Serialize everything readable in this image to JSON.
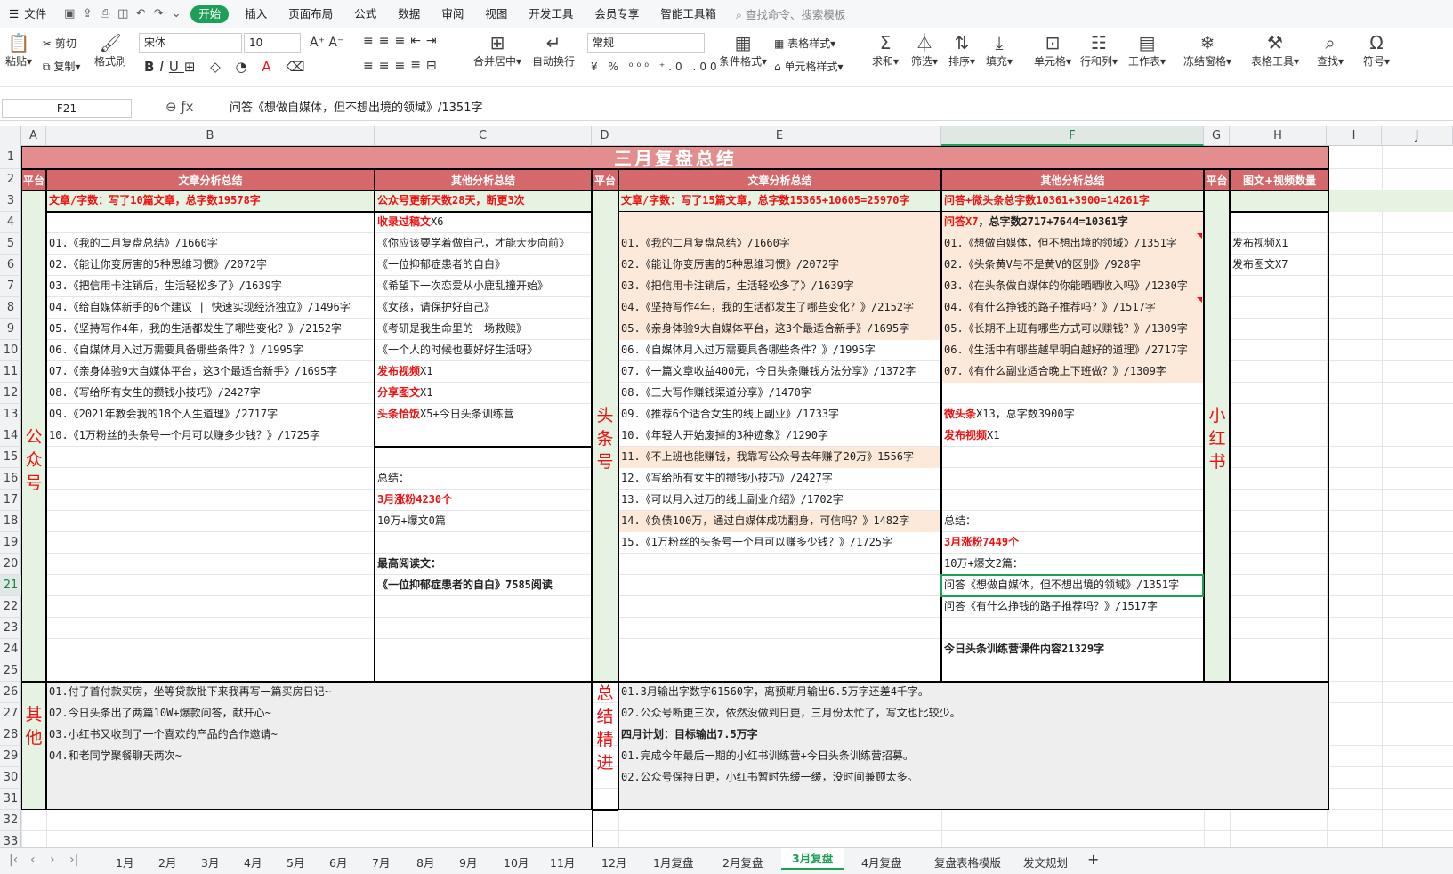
{
  "menu": {
    "file": "文件",
    "tabs": [
      "开始",
      "插入",
      "页面布局",
      "公式",
      "数据",
      "审阅",
      "视图",
      "开发工具",
      "会员专享",
      "智能工具箱"
    ],
    "search": "查找命令、搜索模板"
  },
  "ribbon": {
    "paste": "粘贴",
    "cut": "剪切",
    "copy": "复制",
    "format_painter": "格式刷",
    "font": "宋体",
    "size": "10",
    "merge": "合并居中",
    "wrap": "自动换行",
    "numfmt": "常规",
    "cond_format": "条件格式",
    "table_style": "表格样式",
    "cell_style": "单元格样式",
    "sum": "求和",
    "filter": "筛选",
    "sort": "排序",
    "fill": "填充",
    "cell": "单元格",
    "rowcol": "行和列",
    "sheet": "工作表",
    "freeze": "冻结窗格",
    "tabletools": "表格工具",
    "find": "查找",
    "symbol": "符号"
  },
  "formula_bar": {
    "cell_ref": "F21",
    "content": "问答《想做自媒体，但不想出境的领域》/1351字"
  },
  "columns": [
    "A",
    "B",
    "C",
    "D",
    "E",
    "F",
    "G",
    "H",
    "I",
    "J"
  ],
  "selected_col": "F",
  "selected_row": "21",
  "rows": [
    "1",
    "2",
    "3",
    "4",
    "5",
    "6",
    "7",
    "8",
    "9",
    "10",
    "11",
    "12",
    "13",
    "14",
    "15",
    "16",
    "17",
    "18",
    "19",
    "20",
    "21",
    "22",
    "23",
    "24",
    "25",
    "26",
    "27",
    "28",
    "29",
    "30",
    "31",
    "32",
    "33",
    "34"
  ],
  "sheet": {
    "title": "三月复盘总结",
    "h_platform": "平台",
    "h_article": "文章分析总结",
    "h_other": "其他分析总结",
    "h_xhs": "图文+视频数量",
    "gzh_name": [
      "公",
      "众",
      "号"
    ],
    "tt_name": [
      "头",
      "条",
      "号"
    ],
    "xhs_name": [
      "小",
      "红",
      "书"
    ],
    "other_name": [
      "其",
      "他"
    ],
    "sum_name": [
      "总",
      "结",
      "精",
      "进"
    ],
    "b3": "文章/字数：写了10篇文章，总字数19578字",
    "gzh_articles": [
      "01.《我的二月复盘总结》/1660字",
      "02.《能让你变厉害的5种思维习惯》/2072字",
      "03.《把信用卡注销后，生活轻松多了》/1639字",
      "04.《给自媒体新手的6个建议 | 快速实现经济独立》/1496字",
      "05.《坚持写作4年，我的生活都发生了哪些变化？》/2152字",
      "06.《自媒体月入过万需要具备哪些条件？》/1995字",
      "07.《亲身体验9大自媒体平台，这3个最适合新手》/1695字",
      "08.《写给所有女生的攒钱小技巧》/2427字",
      "09.《2021年教会我的18个人生道理》/2717字",
      "10.《1万粉丝的头条号一个月可以赚多少钱？》/1725字"
    ],
    "c3": "公众号更新天数28天，断更3次",
    "c4_red": "收录过稿文",
    "c4_rest": "X6",
    "c_included": [
      "《你应该要学着做自己，才能大步向前》",
      "《一位抑郁症患者的自白》",
      "《希望下一次恋爱从小鹿乱撞开始》",
      "《女孩，请保护好自己》",
      "《考研是我生命里的一场救赎》",
      "《一个人的时候也要好好生活呀》"
    ],
    "c11_red": "发布视频",
    "c11_rest": "X1",
    "c12_red": "分享图文",
    "c12_rest": "X1",
    "c13_red": "头条恰饭",
    "c13_rest": "X5+今日头条训练营",
    "c16": "总结：",
    "c17": "3月涨粉4230个",
    "c18": "10万+爆文0篇",
    "c20": "最高阅读文：",
    "c21": "《一位抑郁症患者的自白》7585阅读",
    "e3": "文章/字数：写了15篇文章，总字数15365+10605=25970字",
    "tt_articles": [
      "01.《我的二月复盘总结》/1660字",
      "02.《能让你变厉害的5种思维习惯》/2072字",
      "03.《把信用卡注销后，生活轻松多了》/1639字",
      "04.《坚持写作4年，我的生活都发生了哪些变化？》/2152字",
      "05.《亲身体验9大自媒体平台，这3个最适合新手》/1695字",
      "06.《自媒体月入过万需要具备哪些条件？》/1995字",
      "07.《一篇文章收益400元，今日头条赚钱方法分享》/1372字",
      "08.《三大写作赚钱渠道分享》/1470字",
      "09.《推荐6个适合女生的线上副业》/1733字",
      "10.《年轻人开始废掉的3种迹象》/1290字",
      "11.《不上班也能赚钱，我靠写公众号去年赚了20万》1556字",
      "12.《写给所有女生的攒钱小技巧》/2427字",
      "13.《可以月入过万的线上副业介绍》/1702字",
      "14.《负债100万，通过自媒体成功翻身，可信吗？》1482字",
      "15.《1万粉丝的头条号一个月可以赚多少钱？》/1725字"
    ],
    "f3": "问答+微头条总字数10361+3900=14261字",
    "f4_red": "问答X7",
    "f4_rest": "，总字数2717+7644=10361字",
    "tt_qa": [
      "01.《想做自媒体，但不想出境的领域》/1351字",
      "02.《头条黄V与不是黄V的区别》/928字",
      "03.《在头条做自媒体的你能晒晒收入吗》/1230字",
      "04.《有什么挣钱的路子推荐吗？》/1517字",
      "05.《长期不上班有哪些方式可以赚钱？》/1309字",
      "06.《生活中有哪些越早明白越好的道理》/2717字",
      "07.《有什么副业适合晚上下班做？》/1309字"
    ],
    "f13_red": "微头条",
    "f13_rest": "X13，总字数3900字",
    "f14_red": "发布视频",
    "f14_rest": "X1",
    "f18": "总结：",
    "f19": "3月涨粉7449个",
    "f20": "10万+爆文2篇：",
    "f21": "问答《想做自媒体，但不想出境的领域》/1351字",
    "f22": "问答《有什么挣钱的路子推荐吗？》/1517字",
    "f24": "今日头条训练营课件内容21329字",
    "h4": "发布视频X1",
    "h5": "发布图文X7",
    "other_items": [
      "01.付了首付款买房，坐等贷款批下来我再写一篇买房日记~",
      "02.今日头条出了两篇10W+爆款问答，献开心~",
      "03.小红书又收到了一个喜欢的产品的合作邀请~",
      "04.和老同学聚餐聊天两次~"
    ],
    "sum1": "01.3月输出字数字61560字，离预期月输出6.5万字还差4千字。",
    "sum2": "02.公众号断更三次，依然没做到日更，三月份太忙了，写文也比较少。",
    "april_plan": "四月计划：目标输出7.5万字",
    "april1": "01.完成今年最后一期的小红书训练营+今日头条训练营招募。",
    "april2": "02.公众号保持日更，小红书暂时先缓一缓，没时间兼顾太多。"
  },
  "sheet_tabs": [
    "1月",
    "2月",
    "3月",
    "4月",
    "5月",
    "6月",
    "7月",
    "8月",
    "9月",
    "10月",
    "11月",
    "12月",
    "1月复盘",
    "2月复盘",
    "3月复盘",
    "4月复盘",
    "复盘表格模版",
    "发文规划"
  ],
  "active_tab": "3月复盘",
  "colors": {
    "accent": "#1e9f58",
    "title_bg": "#e48d8f",
    "header_bg": "#d4686a",
    "green": "#e6f3e2",
    "peach": "#fde9d9",
    "red": "#ee1111"
  }
}
